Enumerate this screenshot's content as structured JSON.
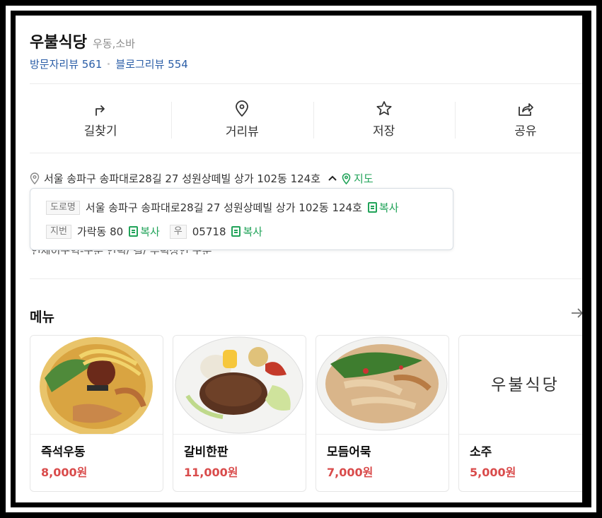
{
  "place": {
    "name": "우불식당",
    "category": "우동,소바",
    "visitor_reviews": "방문자리뷰 561",
    "blog_reviews": "블로그리뷰 554"
  },
  "actions": [
    {
      "label": "길찾기",
      "icon": "directions-icon"
    },
    {
      "label": "거리뷰",
      "icon": "location-pin-icon"
    },
    {
      "label": "저장",
      "icon": "star-icon"
    },
    {
      "label": "공유",
      "icon": "share-icon"
    }
  ],
  "address": {
    "full": "서울 송파구 송파대로28길 27 성원상떼빌 상가 102동 124호",
    "map_label": "지도",
    "popup": {
      "road_tag": "도로명",
      "road_address": "서울 송파구 송파대로28길 27 성원상떼빌 상가 102동 124호",
      "copy_label": "복사",
      "lot_tag": "지번",
      "lot_address": "가락동 80",
      "postal_tag": "우",
      "postal_code": "05718"
    },
    "partially_hidden_text": "인제이구역-구분 인덕/ 길/ 수덕상인 구분"
  },
  "menu": {
    "title": "메뉴",
    "items": [
      {
        "name": "즉석우동",
        "price": "8,000원"
      },
      {
        "name": "갈비한판",
        "price": "11,000원"
      },
      {
        "name": "모듬어묵",
        "price": "7,000원"
      },
      {
        "name": "소주",
        "price": "5,000원",
        "image_text": "우불식당"
      }
    ]
  },
  "colors": {
    "link_blue": "#2b5ea7",
    "green": "#21a359",
    "price_red": "#d94b4b"
  }
}
